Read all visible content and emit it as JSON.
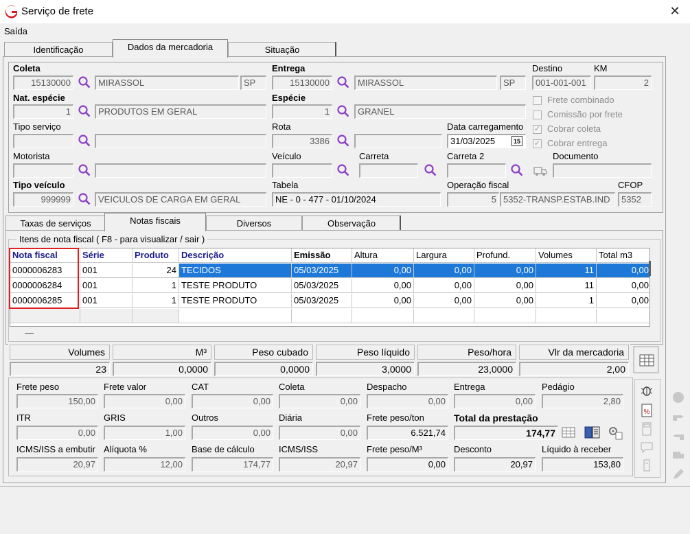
{
  "window": {
    "title": "Serviço de frete",
    "close": "✕"
  },
  "menu": {
    "saida": "Saída"
  },
  "top_tabs": [
    "Identificação",
    "Dados da mercadoria",
    "Situação"
  ],
  "form": {
    "coleta": {
      "label": "Coleta",
      "code": "15130000",
      "city": "MIRASSOL",
      "uf": "SP"
    },
    "entrega": {
      "label": "Entrega",
      "code": "15130000",
      "city": "MIRASSOL",
      "uf": "SP"
    },
    "destino": {
      "label": "Destino",
      "value": "001-001-001"
    },
    "km": {
      "label": "KM",
      "value": "2"
    },
    "nat_especie": {
      "label": "Nat. espécie",
      "code": "1",
      "desc": "PRODUTOS EM GERAL"
    },
    "especie": {
      "label": "Espécie",
      "code": "1",
      "desc": "GRANEL"
    },
    "tipo_servico": {
      "label": "Tipo serviço",
      "code": "",
      "desc": ""
    },
    "rota": {
      "label": "Rota",
      "code": "3386",
      "desc": ""
    },
    "data_carregamento": {
      "label": "Data carregamento",
      "value": "31/03/2025",
      "cal": "15"
    },
    "motorista": {
      "label": "Motorista",
      "code": "",
      "desc": ""
    },
    "veiculo": {
      "label": "Veículo",
      "value": ""
    },
    "carreta": {
      "label": "Carreta",
      "value": ""
    },
    "carreta2": {
      "label": "Carreta 2",
      "value": ""
    },
    "documento": {
      "label": "Documento",
      "value": ""
    },
    "tipo_veiculo": {
      "label": "Tipo veículo",
      "code": "999999",
      "desc": "VEICULOS DE CARGA EM GERAL"
    },
    "tabela": {
      "label": "Tabela",
      "value": "NE - 0 - 477 - 01/10/2024"
    },
    "operacao_fiscal": {
      "label": "Operação fiscal",
      "code": "5",
      "desc": "5352-TRANSP.ESTAB.IND"
    },
    "cfop": {
      "label": "CFOP",
      "value": "5352"
    },
    "checks": [
      {
        "label": "Frete combinado",
        "checked": false
      },
      {
        "label": "Comissão por frete",
        "checked": false
      },
      {
        "label": "Cobrar coleta",
        "checked": true
      },
      {
        "label": "Cobrar entrega",
        "checked": true
      }
    ]
  },
  "sub_tabs": [
    "Taxas de serviços",
    "Notas fiscais",
    "Diversos",
    "Observação"
  ],
  "grid": {
    "group_title": "Itens de nota fiscal ( F8 - para visualizar / sair )",
    "headers": [
      "Nota fiscal",
      "Série",
      "Produto",
      "Descrição",
      "Emissão",
      "Altura",
      "Largura",
      "Profund.",
      "Volumes",
      "Total m3"
    ],
    "rows": [
      [
        "0000006283",
        "001",
        "24",
        "TECIDOS",
        "05/03/2025",
        "0,00",
        "0,00",
        "0,00",
        "11",
        "0,00"
      ],
      [
        "0000006284",
        "001",
        "1",
        "TESTE PRODUTO",
        "05/03/2025",
        "0,00",
        "0,00",
        "0,00",
        "11",
        "0,00"
      ],
      [
        "0000006285",
        "001",
        "1",
        "TESTE PRODUTO",
        "05/03/2025",
        "0,00",
        "0,00",
        "0,00",
        "1",
        "0,00"
      ]
    ],
    "dash": "—"
  },
  "summary": {
    "headers": [
      "Volumes",
      "M³",
      "Peso cubado",
      "Peso líquido",
      "Peso/hora",
      "Vlr da mercadoria"
    ],
    "values": [
      "23",
      "0,0000",
      "0,0000",
      "3,0000",
      "23,0000",
      "2,00"
    ]
  },
  "costs": {
    "row1": [
      {
        "label": "Frete peso",
        "value": "150,00"
      },
      {
        "label": "Frete valor",
        "value": "0,00"
      },
      {
        "label": "CAT",
        "value": "0,00"
      },
      {
        "label": "Coleta",
        "value": "0,00"
      },
      {
        "label": "Despacho",
        "value": "0,00"
      },
      {
        "label": "Entrega",
        "value": "0,00"
      },
      {
        "label": "Pedágio",
        "value": "2,80"
      }
    ],
    "row2": [
      {
        "label": "ITR",
        "value": "0,00"
      },
      {
        "label": "GRIS",
        "value": "1,00"
      },
      {
        "label": "Outros",
        "value": "0,00"
      },
      {
        "label": "Diária",
        "value": "0,00"
      },
      {
        "label": "Frete peso/ton",
        "value": "6.521,74"
      },
      {
        "label": "Total da prestação",
        "value": "174,77"
      }
    ],
    "row3": [
      {
        "label": "ICMS/ISS a embutir",
        "value": "20,97"
      },
      {
        "label": "Alíquota %",
        "value": "12,00"
      },
      {
        "label": "Base de cálculo",
        "value": "174,77"
      },
      {
        "label": "ICMS/ISS",
        "value": "20,97"
      },
      {
        "label": "Frete peso/M³",
        "value": "0,00"
      },
      {
        "label": "Desconto",
        "value": "20,97"
      },
      {
        "label": "Líquido à receber",
        "value": "153,80"
      }
    ]
  },
  "colors": {
    "accent": "#1e78d8",
    "logo": "#d71920",
    "magnifier": "#8b3fc8",
    "highlight": "#e02020"
  }
}
